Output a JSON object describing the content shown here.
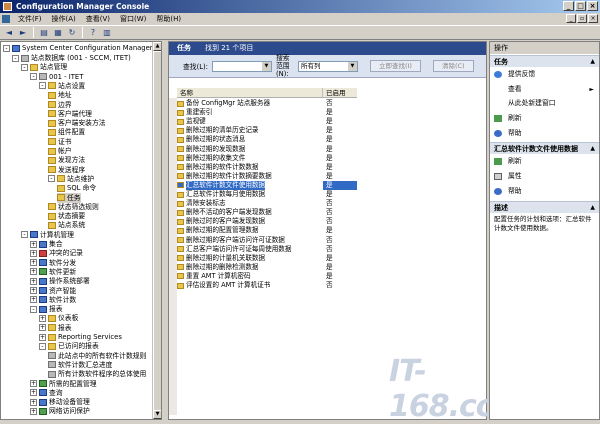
{
  "window": {
    "title": "Configuration Manager Console"
  },
  "menu": [
    "文件(F)",
    "操作(A)",
    "查看(V)",
    "窗口(W)",
    "帮助(H)"
  ],
  "tree": {
    "root": "System Center Configuration Manager",
    "items": [
      {
        "label": "站点数据库 (001 - SCCM, ITET)",
        "level": 1,
        "icon": "database-icon"
      },
      {
        "label": "站点管理",
        "level": 2,
        "icon": "folder-icon"
      },
      {
        "label": "001 - ITET",
        "level": 3,
        "icon": "server-icon"
      },
      {
        "label": "站点设置",
        "level": 4,
        "icon": "folder-icon"
      },
      {
        "label": "地址",
        "level": 5,
        "icon": "folder-icon"
      },
      {
        "label": "边界",
        "level": 5,
        "icon": "folder-icon"
      },
      {
        "label": "客户端代理",
        "level": 5,
        "icon": "folder-icon"
      },
      {
        "label": "客户端安装方法",
        "level": 5,
        "icon": "folder-icon"
      },
      {
        "label": "组件配置",
        "level": 5,
        "icon": "folder-icon"
      },
      {
        "label": "证书",
        "level": 5,
        "icon": "folder-icon"
      },
      {
        "label": "帐户",
        "level": 5,
        "icon": "folder-icon"
      },
      {
        "label": "发现方法",
        "level": 5,
        "icon": "folder-icon"
      },
      {
        "label": "发送程序",
        "level": 5,
        "icon": "folder-icon"
      },
      {
        "label": "站点维护",
        "level": 5,
        "icon": "folder-icon"
      },
      {
        "label": "SQL 命令",
        "level": 6,
        "icon": "folder-icon"
      },
      {
        "label": "任务",
        "level": 6,
        "icon": "folder-icon"
      },
      {
        "label": "状态筛选规则",
        "level": 5,
        "icon": "folder-icon"
      },
      {
        "label": "状态摘要",
        "level": 5,
        "icon": "folder-icon"
      },
      {
        "label": "站点系统",
        "level": 5,
        "icon": "folder-icon"
      },
      {
        "label": "计算机管理",
        "level": 2,
        "icon": "computer-icon"
      },
      {
        "label": "集合",
        "level": 3,
        "icon": "collection-icon"
      },
      {
        "label": "冲突的记录",
        "level": 3,
        "icon": "records-icon"
      },
      {
        "label": "软件分发",
        "level": 3,
        "icon": "distribution-icon"
      },
      {
        "label": "软件更新",
        "level": 3,
        "icon": "update-icon"
      },
      {
        "label": "操作系统部署",
        "level": 3,
        "icon": "os-icon"
      },
      {
        "label": "资产智能",
        "level": 3,
        "icon": "asset-icon"
      },
      {
        "label": "软件计数",
        "level": 3,
        "icon": "metering-icon"
      },
      {
        "label": "报表",
        "level": 3,
        "icon": "reports-icon"
      },
      {
        "label": "仪表板",
        "level": 4,
        "icon": "folder-icon"
      },
      {
        "label": "报表",
        "level": 4,
        "icon": "folder-icon"
      },
      {
        "label": "Reporting Services",
        "level": 4,
        "icon": "folder-icon"
      },
      {
        "label": "已访问的报表",
        "level": 4,
        "icon": "folder-icon"
      },
      {
        "label": "此站点中的所有软件计数规则",
        "level": 5,
        "icon": "report-icon"
      },
      {
        "label": "软件计数汇总进度",
        "level": 5,
        "icon": "report-icon"
      },
      {
        "label": "所有计数软件程序的总体使用",
        "level": 5,
        "icon": "report-icon"
      },
      {
        "label": "所需的配置管理",
        "level": 3,
        "icon": "config-icon"
      },
      {
        "label": "查询",
        "level": 3,
        "icon": "query-icon"
      },
      {
        "label": "移动设备管理",
        "level": 3,
        "icon": "mobile-icon"
      },
      {
        "label": "网络访问保护",
        "level": 3,
        "icon": "nap-icon"
      }
    ],
    "selected_index": 15
  },
  "center": {
    "header_title": "任务",
    "header_count": "找到 21 个项目",
    "search_label": "查找(L):",
    "search_value": "",
    "search_scope_label": "搜索范围(N):",
    "search_scope_value": "所有列",
    "find_now": "立即查找(I)",
    "clear": "清除(C)",
    "col_name": "名称",
    "col_enabled": "已启用",
    "rows": [
      {
        "name": "备份 ConfigMgr 站点服务器",
        "enabled": "否"
      },
      {
        "name": "重建索引",
        "enabled": "是"
      },
      {
        "name": "监视键",
        "enabled": "是"
      },
      {
        "name": "删除过期的清单历史记录",
        "enabled": "是"
      },
      {
        "name": "删除过期的状态消息",
        "enabled": "是"
      },
      {
        "name": "删除过期的发现数据",
        "enabled": "是"
      },
      {
        "name": "删除过期的收集文件",
        "enabled": "是"
      },
      {
        "name": "删除过期的软件计数数据",
        "enabled": "是"
      },
      {
        "name": "删除过期的软件计数摘要数据",
        "enabled": "是"
      },
      {
        "name": "汇总软件计数文件使用数据",
        "enabled": "是"
      },
      {
        "name": "汇总软件计数每月使用数据",
        "enabled": "是"
      },
      {
        "name": "清除安装标志",
        "enabled": "否"
      },
      {
        "name": "删除不活动的客户端发现数据",
        "enabled": "否"
      },
      {
        "name": "删除过时的客户端发现数据",
        "enabled": "否"
      },
      {
        "name": "删除过期的配置管理数据",
        "enabled": "是"
      },
      {
        "name": "删除过期的客户端访问许可证数据",
        "enabled": "否"
      },
      {
        "name": "汇总客户端访问许可证每周使用数据",
        "enabled": "否"
      },
      {
        "name": "删除过期的计量机关联数据",
        "enabled": "是"
      },
      {
        "name": "删除过期的删除检测数据",
        "enabled": "是"
      },
      {
        "name": "重置 AMT 计算机密码",
        "enabled": "是"
      },
      {
        "name": "评估设置的 AMT 计算机证书",
        "enabled": "否"
      }
    ],
    "selected_row": 9,
    "watermark": "IT-168.com"
  },
  "actions": {
    "pane_title": "操作",
    "sections": [
      {
        "title": "任务",
        "items": [
          {
            "label": "提供反馈",
            "icon": "feedback-icon"
          },
          {
            "label": "查看",
            "icon": "",
            "submenu": true
          },
          {
            "label": "从此处新建窗口",
            "icon": ""
          },
          {
            "label": "刷新",
            "icon": "refresh-icon"
          },
          {
            "label": "帮助",
            "icon": "help-icon"
          }
        ]
      },
      {
        "title": "汇总软件计数文件使用数据",
        "items": [
          {
            "label": "刷新",
            "icon": "refresh-icon"
          },
          {
            "label": "属性",
            "icon": "properties-icon"
          },
          {
            "label": "帮助",
            "icon": "help-icon"
          }
        ]
      },
      {
        "title": "描述",
        "description": "配置任务的计划和选项：汇总软件计数文件使用数据。"
      }
    ]
  }
}
